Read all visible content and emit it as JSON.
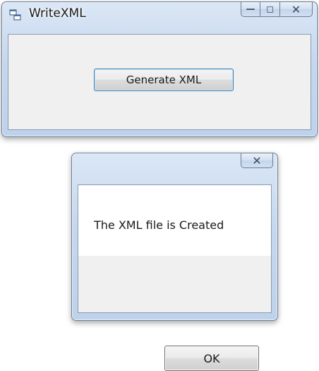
{
  "main_window": {
    "title": "WriteXML",
    "icon": "app-form-icon",
    "caption_buttons": {
      "minimize": "—",
      "maximize": "◻",
      "close": "✕"
    },
    "generate_button_label": "Generate XML"
  },
  "message_box": {
    "close": "✕",
    "message": "The XML file is Created",
    "ok_label": "OK"
  }
}
